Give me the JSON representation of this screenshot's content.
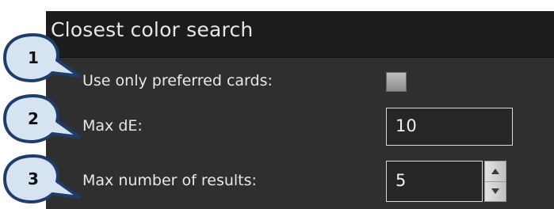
{
  "panel": {
    "title": "Closest color search"
  },
  "rows": [
    {
      "label": "Use only preferred cards:",
      "control": "checkbox",
      "checked": false
    },
    {
      "label": "Max dE:",
      "control": "text-field",
      "value": "10"
    },
    {
      "label": "Max number of results:",
      "control": "spin-field",
      "value": "5"
    }
  ],
  "callouts": [
    "1",
    "2",
    "3"
  ],
  "colors": {
    "callout_fill": "#d6e3f1",
    "callout_stroke": "#1f3d6b",
    "panel_bg": "#2f2f2f",
    "header_bg": "#1c1c1c"
  }
}
